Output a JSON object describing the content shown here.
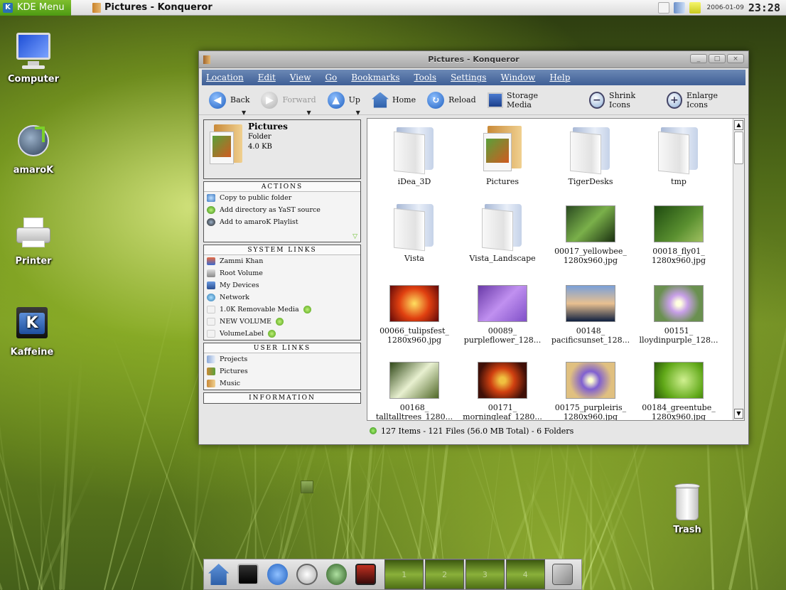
{
  "top_panel": {
    "menu_label": "KDE Menu",
    "task_title": "Pictures - Konqueror",
    "date": "2006-01-09",
    "clock": "23:28"
  },
  "desktop_icons": [
    {
      "label": "Computer"
    },
    {
      "label": "amaroK"
    },
    {
      "label": "Printer"
    },
    {
      "label": "Kaffeine"
    },
    {
      "label": "Trash"
    }
  ],
  "window": {
    "title": "Pictures - Konqueror",
    "menu": [
      "Location",
      "Edit",
      "View",
      "Go",
      "Bookmarks",
      "Tools",
      "Settings",
      "Window",
      "Help"
    ],
    "toolbar": {
      "back": "Back",
      "forward": "Forward",
      "up": "Up",
      "home": "Home",
      "reload": "Reload",
      "storage": "Storage Media",
      "shrink": "Shrink Icons",
      "enlarge": "Enlarge Icons"
    },
    "info": {
      "name": "Pictures",
      "kind": "Folder",
      "size": "4.0 KB"
    },
    "actions": {
      "header": "ACTIONS",
      "items": [
        "Copy to public folder",
        "Add directory as YaST source",
        "Add to amaroK Playlist"
      ]
    },
    "system_links": {
      "header": "SYSTEM LINKS",
      "items": [
        "Zammi Khan",
        "Root Volume",
        "My Devices",
        "Network",
        "1.0K Removable Media",
        "NEW VOLUME",
        "VolumeLabel"
      ]
    },
    "user_links": {
      "header": "USER LINKS",
      "items": [
        "Projects",
        "Pictures",
        "Music"
      ]
    },
    "information": {
      "header": "INFORMATION"
    },
    "files": [
      {
        "l1": "iDea_3D",
        "l2": ""
      },
      {
        "l1": "Pictures",
        "l2": ""
      },
      {
        "l1": "TigerDesks",
        "l2": ""
      },
      {
        "l1": "tmp",
        "l2": ""
      },
      {
        "l1": "Vista",
        "l2": ""
      },
      {
        "l1": "Vista_Landscape",
        "l2": ""
      },
      {
        "l1": "00017_yellowbee_",
        "l2": "1280x960.jpg"
      },
      {
        "l1": "00018_fly01_",
        "l2": "1280x960.jpg"
      },
      {
        "l1": "00066_tulipsfest_",
        "l2": "1280x960.jpg"
      },
      {
        "l1": "00089_",
        "l2": "purpleflower_128..."
      },
      {
        "l1": "00148_",
        "l2": "pacificsunset_128..."
      },
      {
        "l1": "00151_",
        "l2": "lloydinpurple_128..."
      },
      {
        "l1": "00168_",
        "l2": "talltalltrees_1280..."
      },
      {
        "l1": "00171_",
        "l2": "morningleaf_1280..."
      },
      {
        "l1": "00175_purpleiris_",
        "l2": "1280x960.jpg"
      },
      {
        "l1": "00184_greentube_",
        "l2": "1280x960.jpg"
      }
    ],
    "status": "127 Items - 121 Files (56.0 MB Total) - 6 Folders"
  },
  "dock": {
    "desktops": [
      "1",
      "2",
      "3",
      "4"
    ]
  }
}
